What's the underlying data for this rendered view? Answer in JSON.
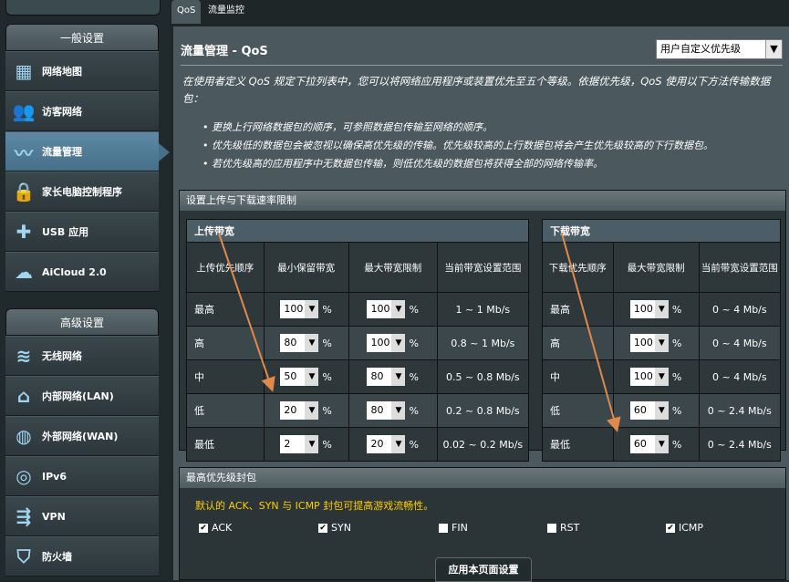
{
  "sidebar": {
    "general_header": "一般设置",
    "advanced_header": "高级设置",
    "general_items": [
      {
        "label": "网络地图",
        "icon": "network-map-icon",
        "glyph": "▦"
      },
      {
        "label": "访客网络",
        "icon": "guest-network-icon",
        "glyph": "👥"
      },
      {
        "label": "流量管理",
        "icon": "traffic-manager-icon",
        "glyph": "〰",
        "active": true
      },
      {
        "label": "家长电脑控制程序",
        "icon": "parental-control-icon",
        "glyph": "🔒"
      },
      {
        "label": "USB 应用",
        "icon": "usb-puzzle-icon",
        "glyph": "✚"
      },
      {
        "label": "AiCloud 2.0",
        "icon": "cloud-icon",
        "glyph": "☁"
      }
    ],
    "advanced_items": [
      {
        "label": "无线网络",
        "icon": "wireless-icon",
        "glyph": "≋"
      },
      {
        "label": "内部网络(LAN)",
        "icon": "home-lan-icon",
        "glyph": "⌂"
      },
      {
        "label": "外部网络(WAN)",
        "icon": "globe-wan-icon",
        "glyph": "◍"
      },
      {
        "label": "IPv6",
        "icon": "ipv6-icon",
        "glyph": "◎"
      },
      {
        "label": "VPN",
        "icon": "vpn-icon",
        "glyph": "⇶"
      },
      {
        "label": "防火墙",
        "icon": "firewall-shield-icon",
        "glyph": "⛉"
      }
    ]
  },
  "tabs": [
    {
      "label": "QoS",
      "active": true
    },
    {
      "label": "流量监控",
      "active": false
    }
  ],
  "page": {
    "title": "流量管理 - QoS",
    "mode_select": "用户自定义优先级",
    "description": "在使用者定义 QoS 规定下拉列表中，您可以将网络应用程序或装置优先至五个等级。依据优先级，QoS 使用以下方法传输数据包：",
    "bullets": [
      "更换上行网络数据包的顺序，可参照数据包传输至网络的顺序。",
      "优先级低的数据包会被忽视以确保高优先级的传输。优先级较高的上行数据包将会产生优先级较高的下行数据包。",
      "若优先级高的应用程序中无数据包传输，则低优先级的数据包将获得全部的网络传输率。"
    ]
  },
  "bandwidth": {
    "section_title": "设置上传与下载速率限制",
    "upload": {
      "header": "上传带宽",
      "columns": [
        "上传优先顺序",
        "最小保留带宽",
        "最大带宽限制",
        "当前带宽设置范围"
      ],
      "rows": [
        {
          "priority": "最高",
          "min": "100",
          "max": "100",
          "range": "1 ~ 1 Mb/s"
        },
        {
          "priority": "高",
          "min": "80",
          "max": "100",
          "range": "0.8 ~ 1 Mb/s"
        },
        {
          "priority": "中",
          "min": "50",
          "max": "80",
          "range": "0.5 ~ 0.8 Mb/s"
        },
        {
          "priority": "低",
          "min": "20",
          "max": "80",
          "range": "0.2 ~ 0.8 Mb/s"
        },
        {
          "priority": "最低",
          "min": "2",
          "max": "20",
          "range": "0.02 ~ 0.2 Mb/s"
        }
      ]
    },
    "download": {
      "header": "下载带宽",
      "columns": [
        "下载优先顺序",
        "最大带宽限制",
        "当前带宽设置范围"
      ],
      "rows": [
        {
          "priority": "最高",
          "max": "100",
          "range": "0 ~ 4 Mb/s"
        },
        {
          "priority": "高",
          "max": "100",
          "range": "0 ~ 4 Mb/s"
        },
        {
          "priority": "中",
          "max": "100",
          "range": "0 ~ 4 Mb/s"
        },
        {
          "priority": "低",
          "max": "60",
          "range": "0 ~ 2.4 Mb/s"
        },
        {
          "priority": "最低",
          "max": "60",
          "range": "0 ~ 2.4 Mb/s"
        }
      ]
    },
    "pct": "%"
  },
  "packets": {
    "section_title": "最高优先级封包",
    "note": "默认的 ACK、SYN 与 ICMP 封包可提高游戏流畅性。",
    "items": [
      {
        "label": "ACK",
        "checked": true
      },
      {
        "label": "SYN",
        "checked": true
      },
      {
        "label": "FIN",
        "checked": false
      },
      {
        "label": "RST",
        "checked": false
      },
      {
        "label": "ICMP",
        "checked": true
      }
    ]
  },
  "apply_label": "应用本页面设置",
  "colors": {
    "accent": "#466f88",
    "note": "#ffcc00",
    "arrow": "#e08a4a"
  }
}
